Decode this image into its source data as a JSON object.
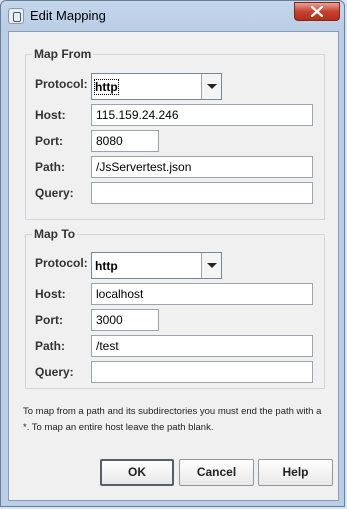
{
  "window": {
    "title": "Edit Mapping"
  },
  "map_from": {
    "title": "Map From",
    "protocol_label": "Protocol:",
    "protocol_value": "http",
    "host_label": "Host:",
    "host_value": "115.159.24.246",
    "port_label": "Port:",
    "port_value": "8080",
    "path_label": "Path:",
    "path_value": "/JsServertest.json",
    "query_label": "Query:",
    "query_value": ""
  },
  "map_to": {
    "title": "Map To",
    "protocol_label": "Protocol:",
    "protocol_value": "http",
    "host_label": "Host:",
    "host_value": "localhost",
    "port_label": "Port:",
    "port_value": "3000",
    "path_label": "Path:",
    "path_value": "/test",
    "query_label": "Query:",
    "query_value": ""
  },
  "note": "To map from a path and its subdirectories you must end the path with a *. To map an entire host leave the path blank.",
  "buttons": {
    "ok": "OK",
    "cancel": "Cancel",
    "help": "Help"
  }
}
